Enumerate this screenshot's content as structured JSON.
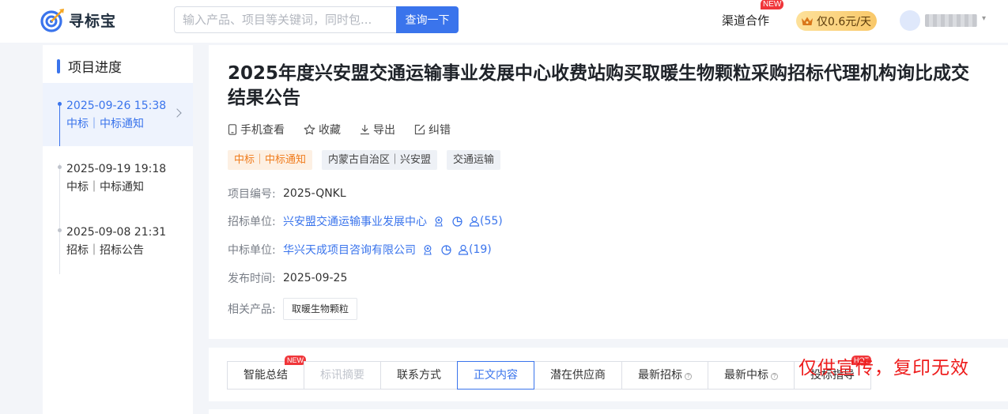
{
  "header": {
    "logo_text": "寻标宝",
    "search_placeholder": "输入产品、项目等关键词，同时包...",
    "search_button": "查询一下",
    "channel_label": "渠道合作",
    "channel_badge": "NEW",
    "promo_label": "仅0.6元/天"
  },
  "sidebar": {
    "title": "项目进度",
    "items": [
      {
        "datetime": "2025-09-26 15:38",
        "type": "中标｜中标通知",
        "active": true
      },
      {
        "datetime": "2025-09-19 19:18",
        "type": "中标｜中标通知",
        "active": false
      },
      {
        "datetime": "2025-09-08 21:31",
        "type": "招标｜招标公告",
        "active": false
      }
    ]
  },
  "main": {
    "title": "2025年度兴安盟交通运输事业发展中心收费站购买取暖生物颗粒采购招标代理机构询比成交结果公告",
    "actions": [
      "手机查看",
      "收藏",
      "导出",
      "纠错"
    ],
    "tags": [
      "中标｜中标通知",
      "内蒙古自治区｜兴安盟",
      "交通运输"
    ],
    "fields": {
      "project_no_label": "项目编号:",
      "project_no": "2025-QNKL",
      "buyer_label": "招标单位:",
      "buyer": "兴安盟交通运输事业发展中心",
      "buyer_count": "(55)",
      "winner_label": "中标单位:",
      "winner": "华兴天成项目咨询有限公司",
      "winner_count": "(19)",
      "publish_label": "发布时间:",
      "publish_date": "2025-09-25",
      "product_label": "相关产品:",
      "product": "取暖生物颗粒"
    }
  },
  "tabs": {
    "items": [
      "智能总结",
      "标讯摘要",
      "联系方式",
      "正文内容",
      "潜在供应商",
      "最新招标",
      "最新中标",
      "投标指导"
    ],
    "new_badge": "NEW",
    "hot_badge": "HOT"
  },
  "watermark": "仅供宣传，复印无效",
  "colors": {
    "accent": "#3a74ec",
    "orange": "#f07b1b",
    "badge_red": "#f0363a",
    "watermark_red": "#ee1c1c"
  }
}
